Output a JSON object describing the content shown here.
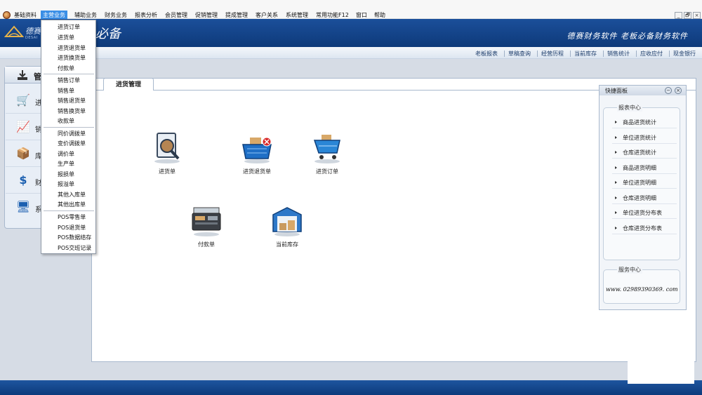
{
  "menubar": {
    "items": [
      "基础资料",
      "主营业务",
      "辅助业务",
      "财务业务",
      "报表分析",
      "会员管理",
      "促销管理",
      "提成管理",
      "客户关系",
      "系统管理",
      "常用功能F12",
      "窗口",
      "帮助"
    ],
    "active": "主营业务",
    "window_buttons": [
      "_",
      "🗗",
      "×"
    ]
  },
  "banner": {
    "logo_text": "德赛",
    "logo_sub": "DESAI",
    "title": "必备",
    "slogan": "德赛财务软件 老板必备财务软件"
  },
  "toolbar": {
    "links": [
      "老板报表",
      "草稿查询",
      "经营历程",
      "当前库存",
      "销售统计",
      "应收应付",
      "现金银行"
    ]
  },
  "dropdown": {
    "groups": [
      [
        "进货订单",
        "进货单",
        "进货退货单",
        "进货换货单",
        "付款单"
      ],
      [
        "销售订单",
        "销售单",
        "销售退货单",
        "销售换货单",
        "收款单"
      ],
      [
        "同价调拨单",
        "变价调拨单",
        "调价单",
        "生产单",
        "报损单",
        "报溢单",
        "其他入库单",
        "其他出库单"
      ],
      [
        "POS零售单",
        "POS退货单",
        "POS数据结存",
        "POS交班记录"
      ]
    ]
  },
  "leftnav": {
    "title": "管",
    "items": [
      {
        "label": "进",
        "icon": "cart-icon"
      },
      {
        "label": "销",
        "icon": "chart-up-icon"
      },
      {
        "label": "库",
        "icon": "storage-icon"
      },
      {
        "label": "财",
        "icon": "dollar-icon"
      },
      {
        "label": "系",
        "icon": "monitor-icon"
      }
    ]
  },
  "main": {
    "tab": "进货管理",
    "features": [
      {
        "label": "进货单",
        "icon": "magnifier-document-icon"
      },
      {
        "label": "进货退货单",
        "icon": "basket-return-icon"
      },
      {
        "label": "进货订单",
        "icon": "cart-order-icon"
      },
      {
        "label": "付款单",
        "icon": "cash-register-icon"
      },
      {
        "label": "当前库存",
        "icon": "warehouse-icon"
      }
    ]
  },
  "quick_panel": {
    "title": "快捷面板",
    "report_center": "报表中心",
    "reports": [
      "商品进货统计",
      "单位进货统计",
      "仓库进货统计",
      "商品进货明细",
      "单位进货明细",
      "仓库进货明细",
      "单位进货分布表",
      "仓库进货分布表"
    ],
    "service_center": "服务中心",
    "phone": "www. 02989390369. com"
  },
  "colors": {
    "banner": "#0e3a7a",
    "menu_active": "#3a8ee6"
  }
}
